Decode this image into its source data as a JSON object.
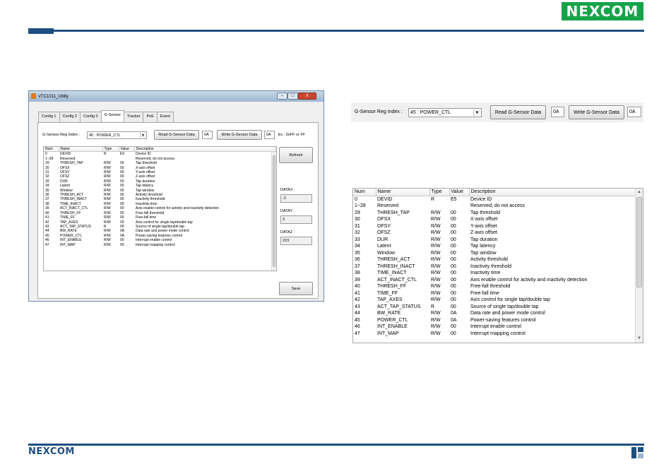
{
  "brand": {
    "name": "NEXCOM"
  },
  "window": {
    "title": "VTC1011_Utility",
    "controls": {
      "minimize": "‒",
      "maximize": "□",
      "close": "X"
    },
    "tabs": [
      {
        "label": "Config 1",
        "active": false
      },
      {
        "label": "Config 2",
        "active": false
      },
      {
        "label": "Config 3",
        "active": false
      },
      {
        "label": "G-Sensor",
        "active": true
      },
      {
        "label": "Tracker",
        "active": false
      },
      {
        "label": "PoE",
        "active": false
      },
      {
        "label": "Event",
        "active": false
      }
    ],
    "reg_index_label": "G-Sensor Reg Index :",
    "reg_index_value": "45 : POWER_CTL",
    "read_button": "Read G-Sensor Data",
    "read_value": "0A",
    "write_button": "Write G-Sensor Data",
    "write_value": "0A",
    "hint": "Ex : 0xFF or FF",
    "refresh_button": "Refresh",
    "datax_label": "DATAX :",
    "datax_value": "-2",
    "datay_label": "DATAY :",
    "datay_value": "3",
    "dataz_label": "DATAZ :",
    "dataz_value": "223",
    "save_button": "Save"
  },
  "columns": [
    "Num",
    "Name",
    "Type",
    "Value",
    "Description"
  ],
  "registers": [
    {
      "num": "0",
      "name": "DEVID",
      "type": "R",
      "value": "E5",
      "desc": "Device ID"
    },
    {
      "num": "1~28",
      "name": "Reserved",
      "type": "",
      "value": "",
      "desc": "Reserved; do not access"
    },
    {
      "num": "29",
      "name": "THRESH_TAP",
      "type": "R/W",
      "value": "00",
      "desc": "Tap threshold"
    },
    {
      "num": "30",
      "name": "OFSX",
      "type": "R/W",
      "value": "00",
      "desc": "X-axis offset"
    },
    {
      "num": "31",
      "name": "OFSY",
      "type": "R/W",
      "value": "00",
      "desc": "Y-axis offset"
    },
    {
      "num": "32",
      "name": "OFSZ",
      "type": "R/W",
      "value": "00",
      "desc": "Z-axis offset"
    },
    {
      "num": "33",
      "name": "DUR",
      "type": "R/W",
      "value": "00",
      "desc": "Tap duration"
    },
    {
      "num": "34",
      "name": "Latent",
      "type": "R/W",
      "value": "00",
      "desc": "Tap latency"
    },
    {
      "num": "35",
      "name": "Window",
      "type": "R/W",
      "value": "00",
      "desc": "Tap window"
    },
    {
      "num": "36",
      "name": "THRESH_ACT",
      "type": "R/W",
      "value": "00",
      "desc": "Activity threshold"
    },
    {
      "num": "37",
      "name": "THRESH_INACT",
      "type": "R/W",
      "value": "00",
      "desc": "Inactivity threshold"
    },
    {
      "num": "38",
      "name": "TIME_INACT",
      "type": "R/W",
      "value": "00",
      "desc": "Inactivity time"
    },
    {
      "num": "39",
      "name": "ACT_INACT_CTL",
      "type": "R/W",
      "value": "00",
      "desc": "Axis enable control for activity and inactivity detection"
    },
    {
      "num": "40",
      "name": "THRESH_FF",
      "type": "R/W",
      "value": "00",
      "desc": "Free-fall threshold"
    },
    {
      "num": "41",
      "name": "TIME_FF",
      "type": "R/W",
      "value": "00",
      "desc": "Free-fall time"
    },
    {
      "num": "42",
      "name": "TAP_AXES",
      "type": "R/W",
      "value": "00",
      "desc": "Axis control for single tap/double tap"
    },
    {
      "num": "43",
      "name": "ACT_TAP_STATUS",
      "type": "R",
      "value": "00",
      "desc": "Source of single tap/double tap"
    },
    {
      "num": "44",
      "name": "BW_RATE",
      "type": "R/W",
      "value": "0A",
      "desc": "Data rate and power mode control"
    },
    {
      "num": "45",
      "name": "POWER_CTL",
      "type": "R/W",
      "value": "0A",
      "desc": "Power-saving features control"
    },
    {
      "num": "46",
      "name": "INT_ENABLE",
      "type": "R/W",
      "value": "00",
      "desc": "Interrupt enable control"
    },
    {
      "num": "47",
      "name": "INT_MAP",
      "type": "R/W",
      "value": "00",
      "desc": "Interrupt mapping control"
    }
  ],
  "colors": {
    "brand_green": "#16a34a",
    "brand_blue": "#1e4f82"
  }
}
